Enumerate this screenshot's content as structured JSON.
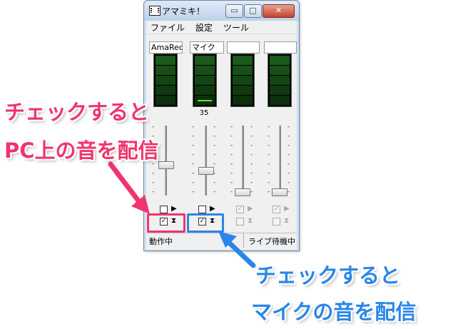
{
  "window": {
    "title": "アマミキ！"
  },
  "titlebar": {
    "minimize": "▭",
    "maximize": "□",
    "close": "✕"
  },
  "menu": [
    "ファイル",
    "設定",
    "ツール"
  ],
  "channels": [
    {
      "label": "AmaRec",
      "enabled": true,
      "level": null,
      "slider": 0.62,
      "play_checked": false,
      "stream_checked": true
    },
    {
      "label": "マイク",
      "enabled": true,
      "level": "35",
      "slider": 0.62,
      "play_checked": false,
      "stream_checked": true
    },
    {
      "label": "",
      "enabled": false,
      "level": null,
      "slider": 0.92,
      "play_checked": true,
      "stream_checked": false
    },
    {
      "label": "",
      "enabled": false,
      "level": null,
      "slider": 0.92,
      "play_checked": true,
      "stream_checked": false
    }
  ],
  "status": {
    "left": "動作中",
    "right": "ライブ待機中"
  },
  "annotations": {
    "pink": {
      "line1": "チェックすると",
      "line2": "PC上の音を配信",
      "color": "#f0356e"
    },
    "blue": {
      "line1": "チェックすると",
      "line2": "マイクの音を配信",
      "color": "#2a86e8"
    }
  },
  "icons": {
    "play": "play-triangle-icon",
    "stream": "film-reel-icon",
    "app": "cassette-icon"
  }
}
